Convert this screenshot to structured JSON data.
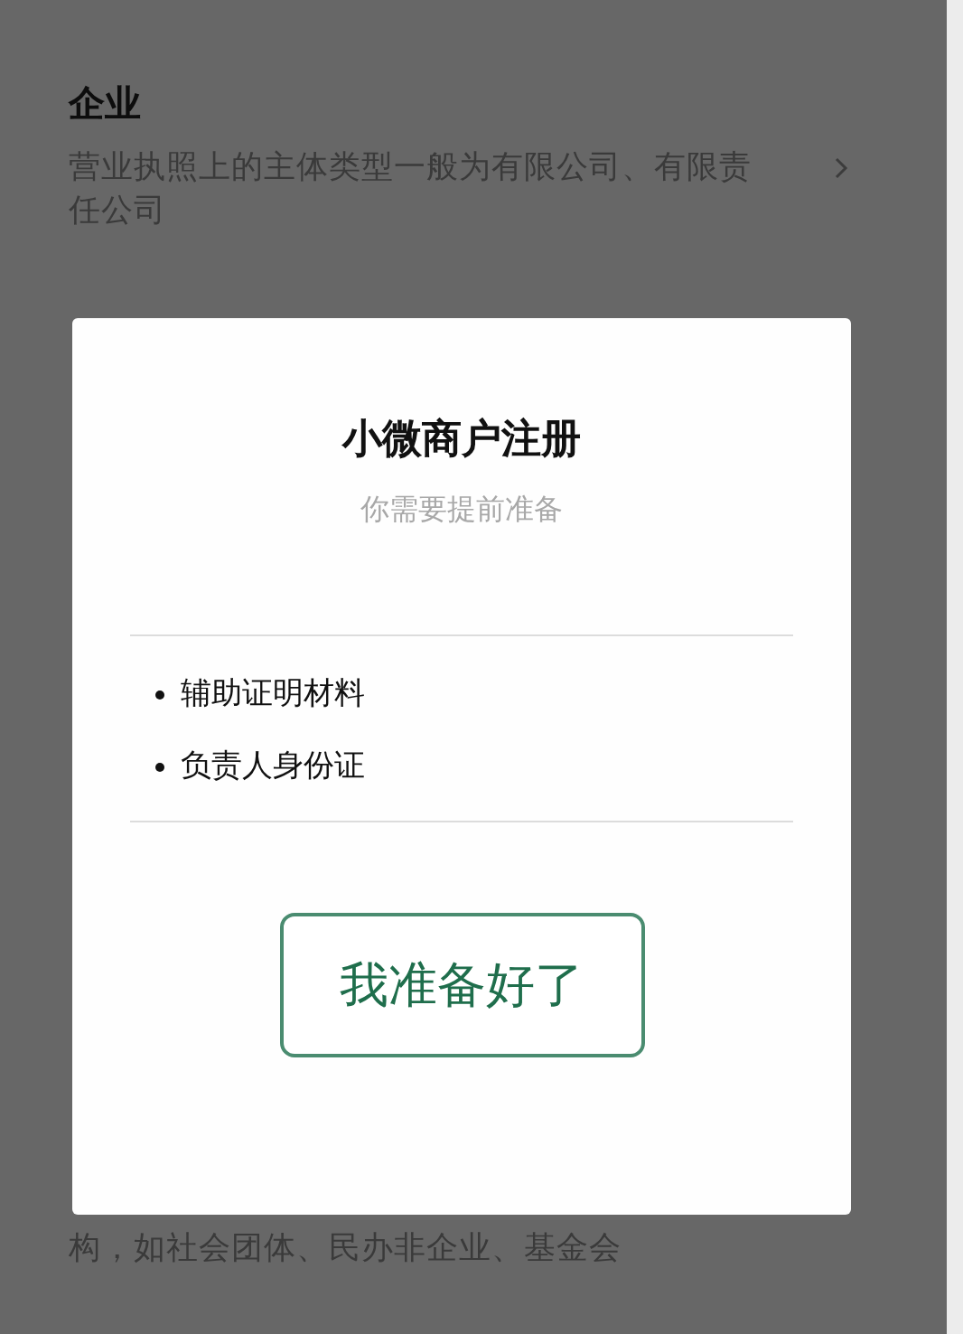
{
  "background_list": {
    "items": [
      {
        "title": "企业",
        "description": "营业执照上的主体类型一般为有限公司、有限责任公司"
      }
    ],
    "partial_description": "构，如社会团体、民办非企业、基金会"
  },
  "dialog": {
    "title": "小微商户注册",
    "subtitle": "你需要提前准备",
    "requirements": [
      "辅助证明材料",
      "负责人身份证"
    ],
    "confirm_button": "我准备好了"
  }
}
